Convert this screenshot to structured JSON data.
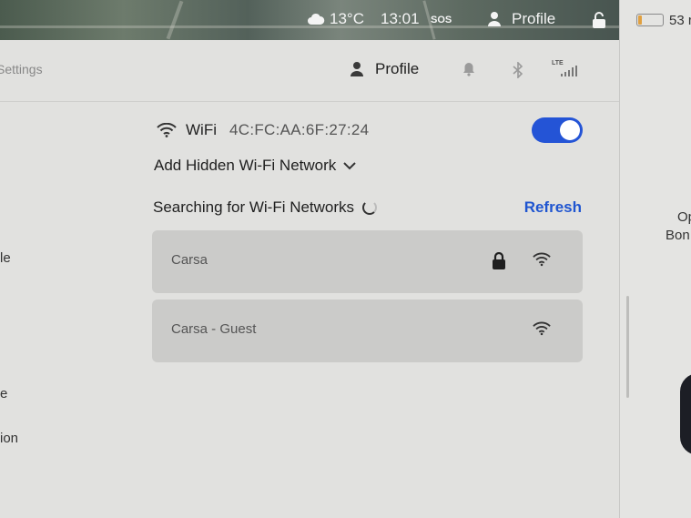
{
  "status_bar": {
    "temperature": "13°C",
    "time": "13:01",
    "sos": "SOS",
    "profile": "Profile"
  },
  "header": {
    "settings": "Settings",
    "profile": "Profile",
    "lte": "LTE"
  },
  "sidebar_fragments": [
    "le",
    "e",
    "ion"
  ],
  "wifi": {
    "title": "WiFi",
    "mac": "4C:FC:AA:6F:27:24",
    "enabled": true,
    "add_hidden": "Add Hidden Wi-Fi Network",
    "searching": "Searching for Wi-Fi Networks",
    "refresh": "Refresh",
    "networks": [
      {
        "name": "Carsa",
        "locked": true
      },
      {
        "name": "Carsa - Guest",
        "locked": false
      }
    ]
  },
  "right_panel": {
    "battery_text": "53 r",
    "battery_level": 0.14,
    "text_op": "Op",
    "text_bon": "Bon"
  },
  "colors": {
    "accent": "#2454d6",
    "refresh": "#1f55d0",
    "panel": "#e1e1df",
    "network_row": "#cbcbc9"
  }
}
